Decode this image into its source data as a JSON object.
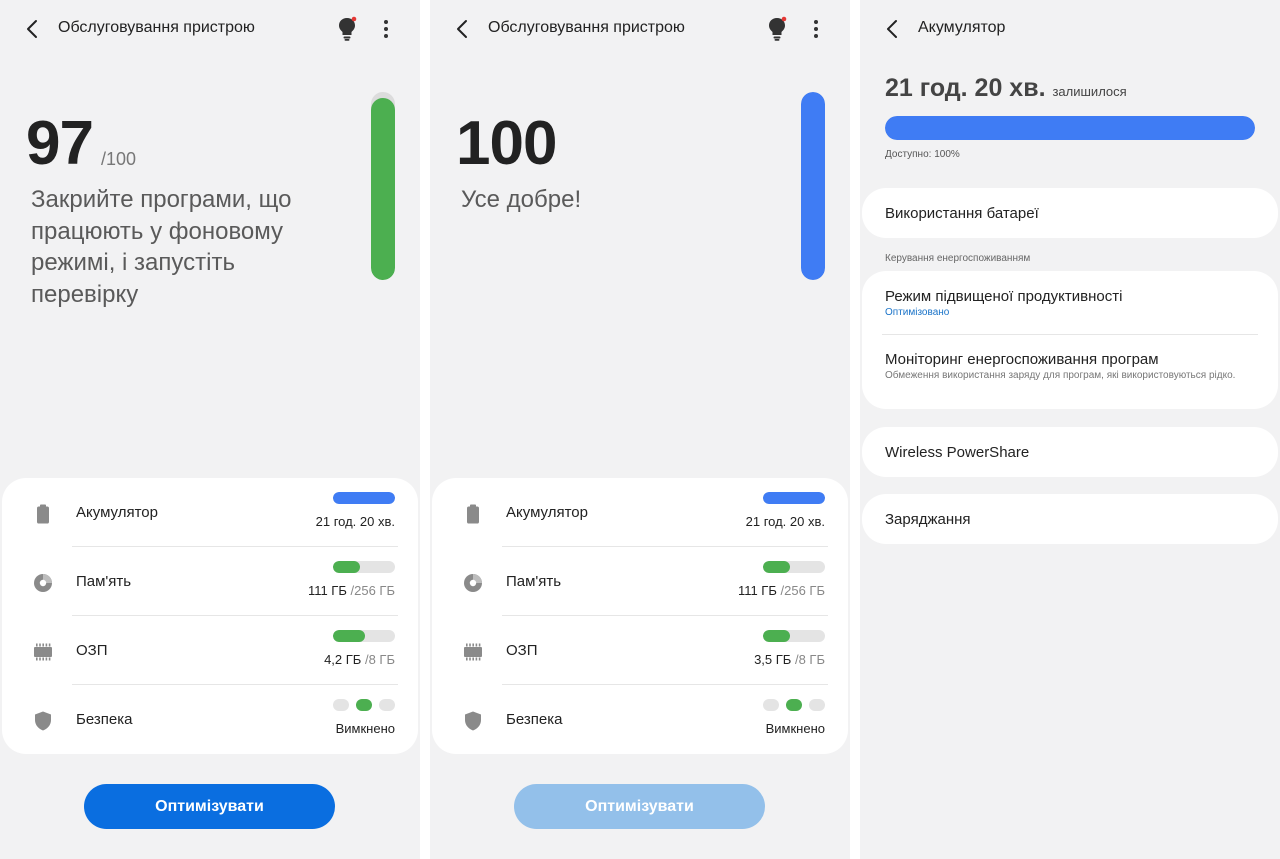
{
  "colors": {
    "green": "#4caf50",
    "blue": "#3f7cf4",
    "button_active": "#0a6ee0",
    "button_disabled": "#93c0ea",
    "link": "#1a73c8"
  },
  "screen1": {
    "title": "Обслуговування пристрою",
    "score": "97",
    "score_max": "/100",
    "message": "Закрийте програми, що працюють у фоновому режимі, і запустіть перевірку",
    "score_level": 0.97,
    "items": [
      {
        "label": "Акумулятор",
        "value": "21 год. 20 хв.",
        "sub": "",
        "level": 1.0,
        "color": "#3f7cf4",
        "icon": "battery-icon"
      },
      {
        "label": "Пам'ять",
        "value": "111 ГБ",
        "sub": "/256 ГБ",
        "level": 0.43,
        "color": "#4caf50",
        "icon": "storage-pie-icon"
      },
      {
        "label": "ОЗП",
        "value": "4,2 ГБ",
        "sub": "/8 ГБ",
        "level": 0.52,
        "color": "#4caf50",
        "icon": "memory-chip-icon"
      },
      {
        "label": "Безпека",
        "value": "Вимкнено",
        "sub": "",
        "active_dot": 1,
        "icon": "shield-icon"
      }
    ],
    "button_label": "Оптимізувати"
  },
  "screen2": {
    "title": "Обслуговування пристрою",
    "score": "100",
    "message": "Усе добре!",
    "score_level": 1.0,
    "items": [
      {
        "label": "Акумулятор",
        "value": "21 год. 20 хв.",
        "sub": "",
        "level": 1.0,
        "color": "#3f7cf4",
        "icon": "battery-icon"
      },
      {
        "label": "Пам'ять",
        "value": "111 ГБ",
        "sub": "/256 ГБ",
        "level": 0.43,
        "color": "#4caf50",
        "icon": "storage-pie-icon"
      },
      {
        "label": "ОЗП",
        "value": "3,5 ГБ",
        "sub": "/8 ГБ",
        "level": 0.44,
        "color": "#4caf50",
        "icon": "memory-chip-icon"
      },
      {
        "label": "Безпека",
        "value": "Вимкнено",
        "sub": "",
        "active_dot": 1,
        "icon": "shield-icon"
      }
    ],
    "button_label": "Оптимізувати"
  },
  "screen3": {
    "title": "Акумулятор",
    "remaining_time": "21 год. 20 хв.",
    "remaining_suffix": "залишилося",
    "battery_level": 1.0,
    "available": "Доступно: 100%",
    "battery_usage": "Використання батареї",
    "section_label": "Керування енергоспоживанням",
    "performance_mode": "Режим підвищеної продуктивності",
    "performance_status": "Оптимізовано",
    "monitoring_title": "Моніторинг енергоспоживання програм",
    "monitoring_desc": "Обмеження використання заряду для програм, які використовуються рідко.",
    "wireless_powershare": "Wireless PowerShare",
    "charging": "Заряджання"
  }
}
